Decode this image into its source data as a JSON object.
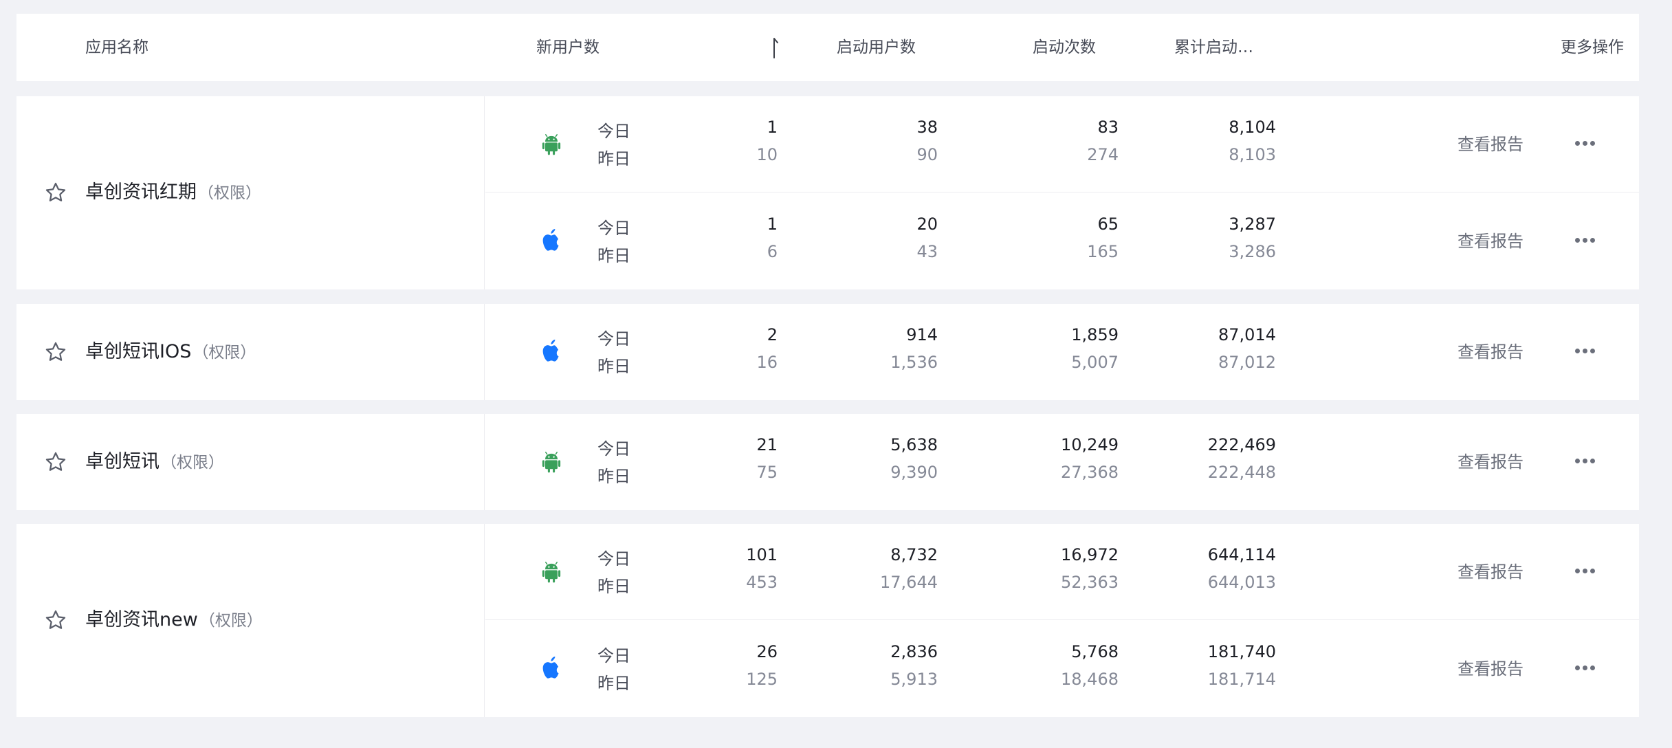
{
  "header": {
    "app_name": "应用名称",
    "new_users": "新用户数",
    "active_users": "启动用户数",
    "launches": "启动次数",
    "cumulative": "累计启动…",
    "more_actions": "更多操作"
  },
  "labels": {
    "today": "今日",
    "yesterday": "昨日",
    "view_report": "查看报告",
    "permission": "（权限）"
  },
  "colors": {
    "android": "#3aa05b",
    "apple": "#1677ff"
  },
  "apps": [
    {
      "name": "卓创资讯红期",
      "rows": [
        {
          "platform": "android-icon",
          "today": [
            "1",
            "38",
            "83",
            "8,104"
          ],
          "yesterday": [
            "10",
            "90",
            "274",
            "8,103"
          ]
        },
        {
          "platform": "apple-icon",
          "today": [
            "1",
            "20",
            "65",
            "3,287"
          ],
          "yesterday": [
            "6",
            "43",
            "165",
            "3,286"
          ]
        }
      ]
    },
    {
      "name": "卓创短讯IOS",
      "rows": [
        {
          "platform": "apple-icon",
          "today": [
            "2",
            "914",
            "1,859",
            "87,014"
          ],
          "yesterday": [
            "16",
            "1,536",
            "5,007",
            "87,012"
          ]
        }
      ]
    },
    {
      "name": "卓创短讯",
      "rows": [
        {
          "platform": "android-icon",
          "today": [
            "21",
            "5,638",
            "10,249",
            "222,469"
          ],
          "yesterday": [
            "75",
            "9,390",
            "27,368",
            "222,448"
          ]
        }
      ]
    },
    {
      "name": "卓创资讯new",
      "rows": [
        {
          "platform": "android-icon",
          "today": [
            "101",
            "8,732",
            "16,972",
            "644,114"
          ],
          "yesterday": [
            "453",
            "17,644",
            "52,363",
            "644,013"
          ]
        },
        {
          "platform": "apple-icon",
          "today": [
            "26",
            "2,836",
            "5,768",
            "181,740"
          ],
          "yesterday": [
            "125",
            "5,913",
            "18,468",
            "181,714"
          ]
        }
      ]
    }
  ]
}
